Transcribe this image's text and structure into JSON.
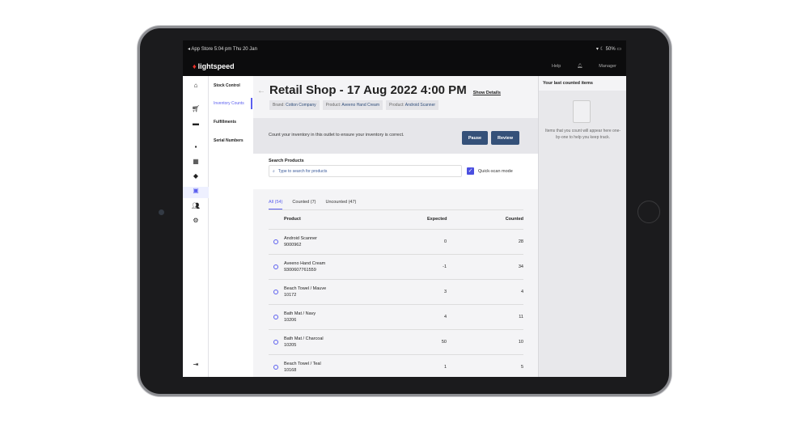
{
  "status": {
    "left": "◂ App Store   5:04 pm   Thu 20 Jan",
    "battery": "50%"
  },
  "header": {
    "brand": "lightspeed",
    "help": "Help",
    "user": "Manager"
  },
  "submenu": [
    "Stock Control",
    "Inventory Counts",
    "Fulfillments",
    "Serial Numbers"
  ],
  "page": {
    "title": "Retail Shop - 17 Aug 2022 4:00 PM",
    "show_details": "Show Details",
    "filters": [
      {
        "k": "Brand:",
        "v": "Cotton Company"
      },
      {
        "k": "Product:",
        "v": "Aveeno Hand Cream"
      },
      {
        "k": "Product:",
        "v": "Android Scanner"
      }
    ]
  },
  "banner": {
    "text": "Count your inventory in this outlet to ensure your inventory is correct.",
    "pause": "Pause",
    "review": "Review"
  },
  "search": {
    "label": "Search Products",
    "placeholder": "Type to search for products",
    "quick_scan": "Quick-scan mode"
  },
  "tabs": [
    "All (54)",
    "Counted (7)",
    "Uncounted (47)"
  ],
  "table": {
    "headers": [
      "Product",
      "Expected",
      "Counted"
    ],
    "rows": [
      {
        "name": "Android Scanner",
        "sku": "9000962",
        "expected": "0",
        "counted": "28"
      },
      {
        "name": "Aveeno Hand Cream",
        "sku": "9300607761559",
        "expected": "-1",
        "counted": "34"
      },
      {
        "name": "Beach Towel / Mauve",
        "sku": "10172",
        "expected": "3",
        "counted": "4"
      },
      {
        "name": "Bath Mat / Navy",
        "sku": "10206",
        "expected": "4",
        "counted": "11"
      },
      {
        "name": "Bath Mat / Charcoal",
        "sku": "10205",
        "expected": "50",
        "counted": "10"
      },
      {
        "name": "Beach Towel / Teal",
        "sku": "10168",
        "expected": "1",
        "counted": "5"
      }
    ]
  },
  "right_panel": {
    "title": "Your last counted items",
    "empty": "Items that you count will appear here one-by-one to help you keep track."
  }
}
